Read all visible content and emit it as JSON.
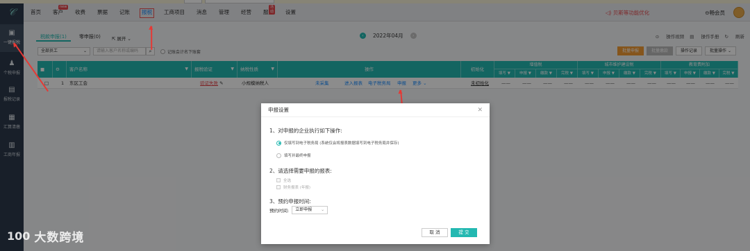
{
  "nav": [
    "首页",
    "客户",
    "收费",
    "票据",
    "记账",
    "报税",
    "工商项目",
    "消息",
    "管理",
    "经营",
    "服务",
    "设置"
  ],
  "nav_badges": {
    "customer": "new",
    "service": "活动"
  },
  "notice": "贝斯等功能优化",
  "member": "畅会员",
  "sidebar": [
    "一键报税",
    "个税申报",
    "报税记录",
    "汇算清缴",
    "工商年报"
  ],
  "tabs": {
    "tax": {
      "label": "税款申报",
      "count": "(1)"
    },
    "zero": {
      "label": "零申报",
      "count": "(0)"
    },
    "expand": "展开"
  },
  "period": "2022年04月",
  "right_links": [
    "操作视频",
    "操作手册",
    "刷新"
  ],
  "filters": {
    "staff": "全部员工",
    "search_placeholder": "请输入客户名称或编码",
    "check_label": "记账会计名下账套"
  },
  "actions": [
    "批量申报",
    "批量缴款",
    "操作记录",
    "批量操作"
  ],
  "table": {
    "headers": {
      "name": "客户名称",
      "verify": "报税验证",
      "type": "纳税性质",
      "ops": "操作",
      "init": "初始化"
    },
    "groups": [
      "增值税",
      "城市维护建设税",
      "教育费附加"
    ],
    "sub_headers": [
      "填写",
      "申报",
      "缴款",
      "完税"
    ],
    "rows": [
      {
        "index": "1",
        "name": "东区工会",
        "verify": "验证失败",
        "type": "小规模纳税人",
        "ops": [
          "未采集",
          "进入报表",
          "电子税务局",
          "申报",
          "更多"
        ],
        "init": "未初始化",
        "cell": "——"
      }
    ]
  },
  "modal": {
    "title": "申报设置",
    "sec1": "1、对申报的企业执行如下操作:",
    "opt1": "仅填写到电子税务局 (系统仅会将报表数据填写到电子税务局并保存)",
    "opt2": "填写并最终申报",
    "sec2": "2、请选择需要申报的报表:",
    "chk1": "全选",
    "chk2": "财务报表 (年报)",
    "sec3": "3、预约申报时间:",
    "time_label": "预约时间:",
    "time_value": "立即申报",
    "cancel": "取 消",
    "submit": "提 交"
  },
  "watermark": "大数跨境",
  "watermark_logo": "100"
}
